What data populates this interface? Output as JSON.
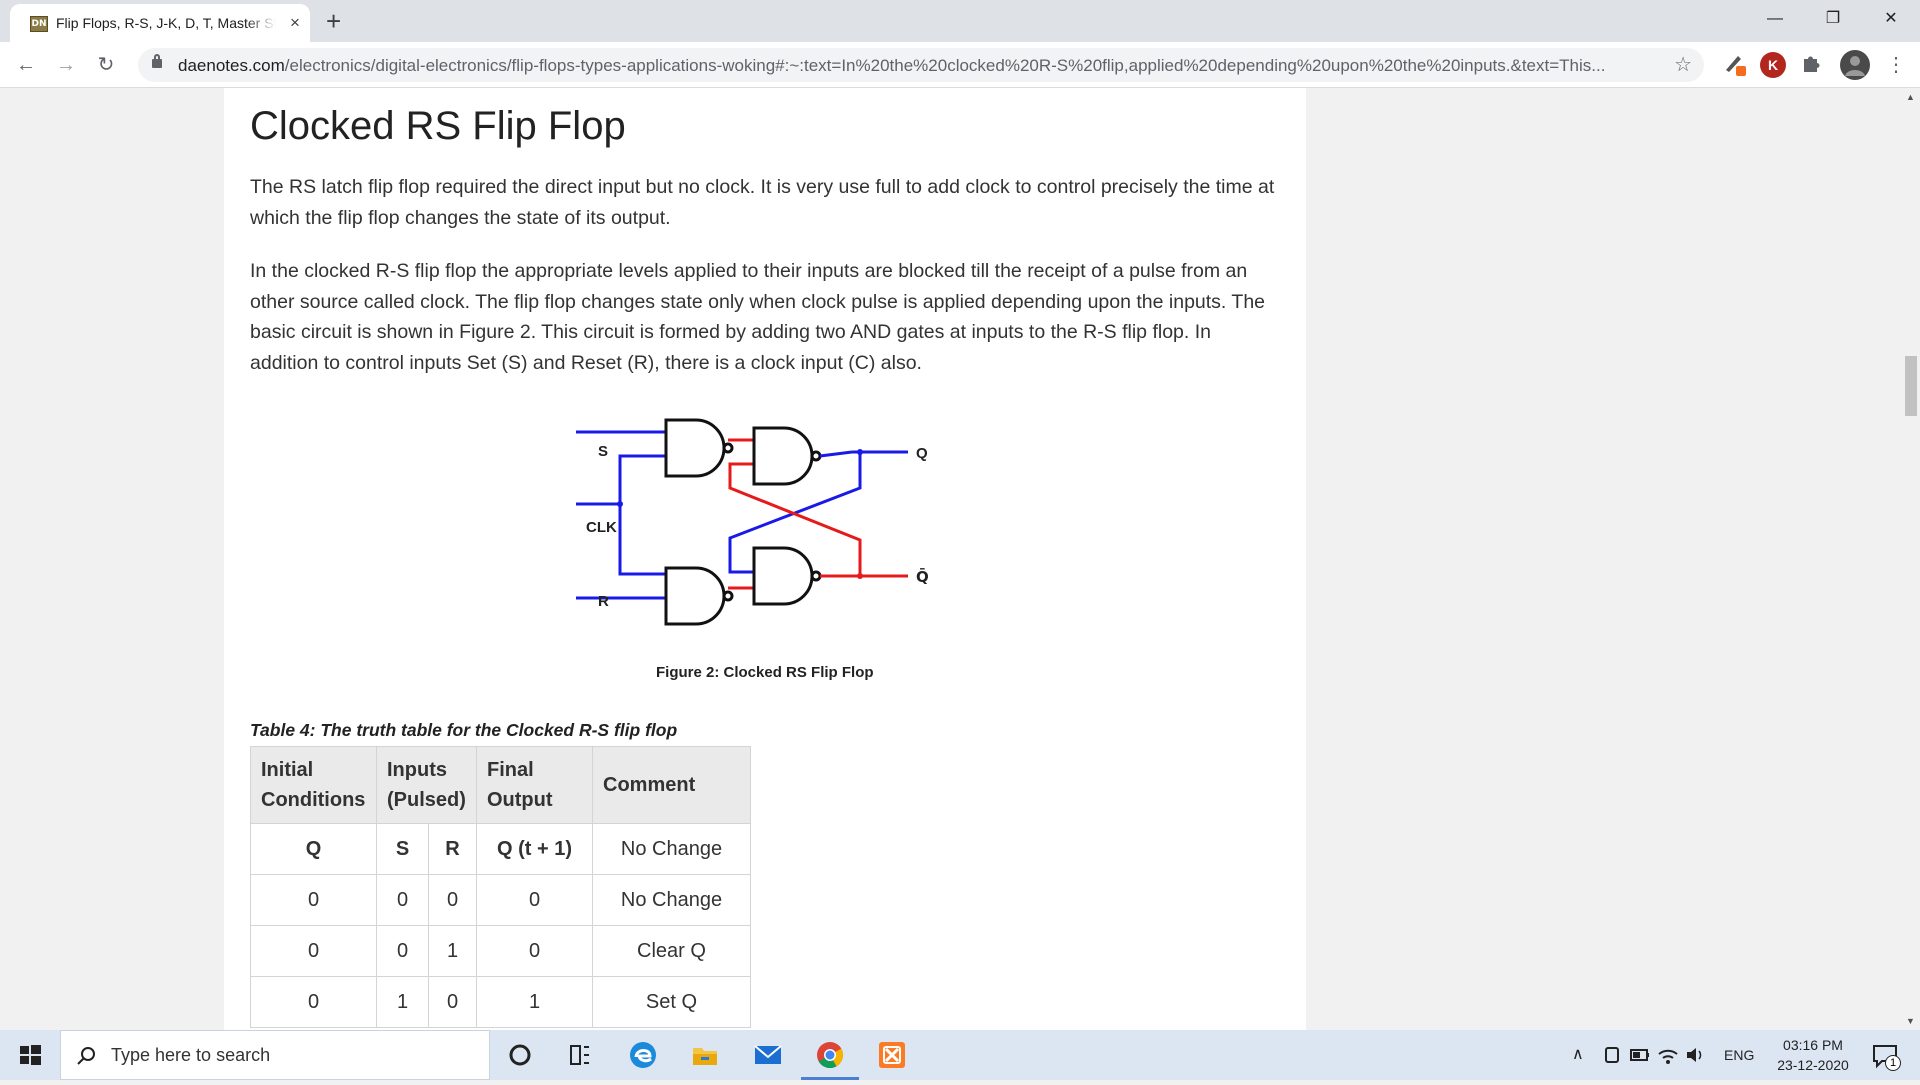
{
  "browser": {
    "tab_title": "Flip Flops, R-S, J-K, D, T, Master Slave",
    "tab_favicon": "DN",
    "close_glyph": "×",
    "new_tab_glyph": "+",
    "url_host": "daenotes.com",
    "url_path": "/electronics/digital-electronics/flip-flops-types-applications-woking#:~:text=In%20the%20clocked%20R-S%20flip,applied%20depending%20upon%20the%20inputs.&text=This...",
    "profile_initial": "K"
  },
  "article": {
    "title": "Clocked RS Flip Flop",
    "para1": "The RS latch flip flop required the direct input but no clock. It is very use full to add clock to control precisely the time at which the flip flop changes the state of its output.",
    "para2": "In the clocked R-S flip flop the appropriate levels applied to their inputs are blocked till the receipt of a pulse from an other source called clock. The flip flop changes state only when clock pulse is applied depending upon the inputs. The basic circuit is shown in Figure 2. This circuit is formed by adding two AND gates at inputs to the R-S flip flop. In addition to control inputs Set (S) and Reset (R), there is a clock input (C) also.",
    "figure": {
      "label_s": "S",
      "label_clk": "CLK",
      "label_r": "R",
      "label_q": "Q",
      "label_qbar": "Q̄",
      "caption": "Figure 2: Clocked RS Flip Flop"
    },
    "table_caption": "Table 4: The truth table for the Clocked R-S flip flop",
    "table": {
      "headers": [
        "Initial Conditions",
        "Inputs (Pulsed)",
        "Final Output",
        "Comment"
      ],
      "header_lines": {
        "h1a": "Initial",
        "h1b": "Conditions",
        "h2a": "Inputs",
        "h2b": "(Pulsed)",
        "h3a": "Final",
        "h3b": "Output",
        "h4": "Comment"
      },
      "subheader": [
        "Q",
        "S",
        "R",
        "Q (t + 1)",
        "No Change"
      ],
      "rows": [
        [
          "0",
          "0",
          "0",
          "0",
          "No Change"
        ],
        [
          "0",
          "0",
          "1",
          "0",
          "Clear Q"
        ],
        [
          "0",
          "1",
          "0",
          "1",
          "Set Q"
        ]
      ]
    }
  },
  "taskbar": {
    "search_placeholder": "Type here to search",
    "language": "ENG",
    "time": "03:16 PM",
    "date": "23-12-2020",
    "notification_count": "1"
  },
  "icons": {
    "back": "←",
    "forward": "→",
    "reload": "↻",
    "star": "☆",
    "menu": "⋮",
    "minimize": "—",
    "restore": "❐",
    "close": "✕"
  }
}
